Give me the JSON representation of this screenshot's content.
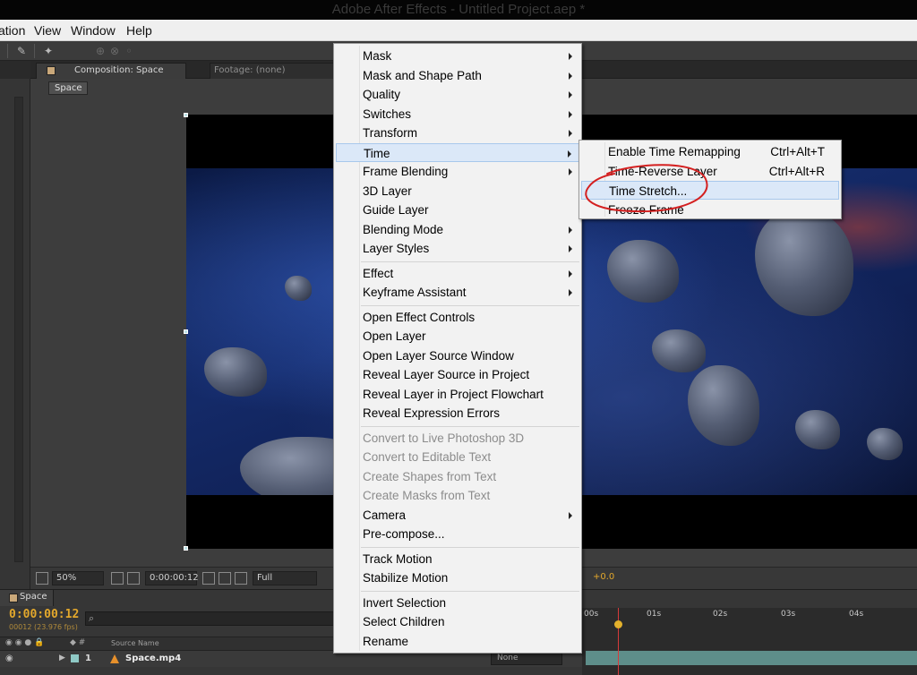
{
  "window": {
    "title": "Adobe After Effects - Untitled Project.aep *"
  },
  "menubar": {
    "items": [
      "ation",
      "View",
      "Window",
      "Help"
    ]
  },
  "composition_panel": {
    "tab_label": "Composition: Space",
    "footage_tab_label": "Footage: (none)",
    "comp_button": "Space"
  },
  "viewer_bar": {
    "zoom": "50%",
    "timecode": "0:00:00:12",
    "resolution": "Full",
    "exposure": "+0.0"
  },
  "timeline": {
    "tab_label": "Space",
    "current_time": "0:00:00:12",
    "frame_info": "00012 (23.976 fps)",
    "column_header": "Source Name",
    "layer_number": "1",
    "layer_name": "Space.mp4",
    "parent_value": "None",
    "ruler_ticks": [
      "00s",
      "01s",
      "02s",
      "03s",
      "04s"
    ]
  },
  "context_menu": {
    "groups": [
      [
        {
          "label": "Mask",
          "submenu": true
        },
        {
          "label": "Mask and Shape Path",
          "submenu": true
        },
        {
          "label": "Quality",
          "submenu": true
        },
        {
          "label": "Switches",
          "submenu": true
        },
        {
          "label": "Transform",
          "submenu": true
        },
        {
          "label": "Time",
          "submenu": true,
          "highlighted": true
        },
        {
          "label": "Frame Blending",
          "submenu": true
        },
        {
          "label": "3D Layer"
        },
        {
          "label": "Guide Layer"
        },
        {
          "label": "Blending Mode",
          "submenu": true
        },
        {
          "label": "Layer Styles",
          "submenu": true
        }
      ],
      [
        {
          "label": "Effect",
          "submenu": true
        },
        {
          "label": "Keyframe Assistant",
          "submenu": true
        }
      ],
      [
        {
          "label": "Open Effect Controls"
        },
        {
          "label": "Open Layer"
        },
        {
          "label": "Open Layer Source Window"
        },
        {
          "label": "Reveal Layer Source in Project"
        },
        {
          "label": "Reveal Layer in Project Flowchart"
        },
        {
          "label": "Reveal Expression Errors"
        }
      ],
      [
        {
          "label": "Convert to Live Photoshop 3D",
          "disabled": true
        },
        {
          "label": "Convert to Editable Text",
          "disabled": true
        },
        {
          "label": "Create Shapes from Text",
          "disabled": true
        },
        {
          "label": "Create Masks from Text",
          "disabled": true
        },
        {
          "label": "Camera",
          "submenu": true
        },
        {
          "label": "Pre-compose..."
        }
      ],
      [
        {
          "label": "Track Motion"
        },
        {
          "label": "Stabilize Motion"
        }
      ],
      [
        {
          "label": "Invert Selection"
        },
        {
          "label": "Select Children"
        },
        {
          "label": "Rename"
        }
      ]
    ]
  },
  "time_submenu": {
    "items": [
      {
        "label": "Enable Time Remapping",
        "shortcut": "Ctrl+Alt+T"
      },
      {
        "label": "Time-Reverse Layer",
        "shortcut": "Ctrl+Alt+R"
      },
      {
        "label": "Time Stretch...",
        "shortcut": "",
        "highlighted": true
      },
      {
        "label": "Freeze Frame",
        "shortcut": ""
      }
    ]
  },
  "colors": {
    "menu_highlight": "#dbe8f8",
    "annotation_circle": "#d42020",
    "timecode": "#e3a82c"
  }
}
